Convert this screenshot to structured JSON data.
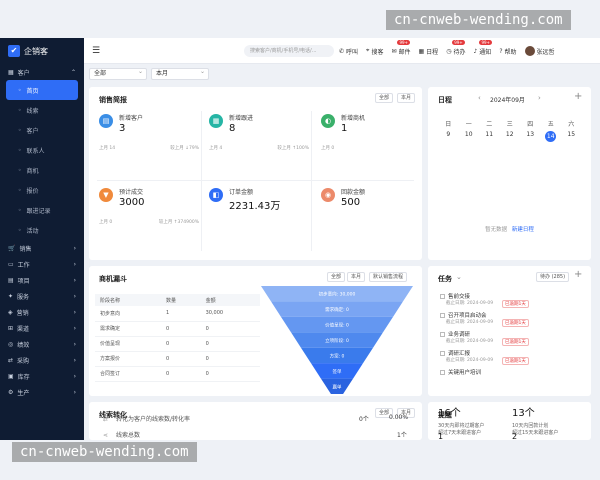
{
  "app": {
    "name": "企销客"
  },
  "watermark": {
    "top": "cn-cnweb-wending.com",
    "bottom": "cn-cnweb-wending.com"
  },
  "sidebar": {
    "groups": [
      {
        "label": "客户",
        "icon": "grid-icon",
        "expanded": true
      },
      {
        "label": "销售",
        "icon": "cart-icon"
      },
      {
        "label": "工作",
        "icon": "work-icon"
      },
      {
        "label": "项目",
        "icon": "project-icon"
      },
      {
        "label": "服务",
        "icon": "service-icon"
      },
      {
        "label": "营销",
        "icon": "marketing-icon"
      },
      {
        "label": "渠道",
        "icon": "channel-icon"
      },
      {
        "label": "绩效",
        "icon": "performance-icon"
      },
      {
        "label": "采购",
        "icon": "purchase-icon"
      },
      {
        "label": "库存",
        "icon": "inventory-icon"
      },
      {
        "label": "生产",
        "icon": "production-icon"
      }
    ],
    "sub_items": [
      {
        "label": "首页",
        "active": true
      },
      {
        "label": "线索"
      },
      {
        "label": "客户"
      },
      {
        "label": "联系人"
      },
      {
        "label": "商机"
      },
      {
        "label": "报价"
      },
      {
        "label": "跟进记录"
      },
      {
        "label": "活动"
      }
    ]
  },
  "topbar": {
    "search_placeholder": "搜索客户/商机/手机号/电话/...",
    "items": [
      {
        "label": "呼叫",
        "icon": "phone-icon"
      },
      {
        "label": "搜客",
        "icon": "location-icon"
      },
      {
        "label": "邮件",
        "icon": "mail-icon",
        "badge": "99+"
      },
      {
        "label": "日程",
        "icon": "calendar-icon"
      },
      {
        "label": "待办",
        "icon": "clock-icon",
        "badge": "99+"
      },
      {
        "label": "通知",
        "icon": "bell-icon",
        "badge": "99+"
      },
      {
        "label": "帮助",
        "icon": "help-icon"
      }
    ],
    "user": "张远哲"
  },
  "filters": {
    "scope": "全部",
    "period": "本月"
  },
  "sales_brief": {
    "title": "销售简报",
    "pills": [
      "全部",
      "本月"
    ],
    "kpis": [
      {
        "label": "新增客户",
        "value": "3",
        "prev": "上月 14",
        "cmp": "较上月 ↓79%",
        "color": "#3a8ee6",
        "icon": "customer-icon"
      },
      {
        "label": "新增跟进",
        "value": "8",
        "prev": "上月 4",
        "cmp": "较上月 ↑100%",
        "color": "#26b5a5",
        "icon": "followup-icon"
      },
      {
        "label": "新增商机",
        "value": "1",
        "prev": "上月 0",
        "cmp": "",
        "color": "#3ab06a",
        "icon": "opportunity-icon"
      },
      {
        "label": "预计成交",
        "value": "3000",
        "prev": "上月 0",
        "cmp": "较上月 ↑374900%",
        "color": "#f08a3c",
        "icon": "deal-icon"
      },
      {
        "label": "订单金额",
        "value": "2231.43万",
        "prev": "",
        "cmp": "",
        "color": "#2f6df6",
        "icon": "order-icon"
      },
      {
        "label": "回款金额",
        "value": "500",
        "prev": "",
        "cmp": "",
        "color": "#ec8a6a",
        "icon": "payment-icon"
      }
    ]
  },
  "calendar": {
    "title": "日程",
    "month": "2024年09月",
    "weekdays": [
      "日",
      "一",
      "二",
      "三",
      "四",
      "五",
      "六"
    ],
    "days": [
      "9",
      "10",
      "11",
      "12",
      "13",
      "14",
      "15"
    ],
    "today": "14",
    "empty": "暂无数据",
    "new_label": "新建日程"
  },
  "funnel": {
    "title": "商机漏斗",
    "pills": [
      "全部",
      "本月",
      "默认销售流程"
    ],
    "columns": [
      "阶段名称",
      "数量",
      "金额"
    ],
    "rows": [
      [
        "初步意向",
        "1",
        "30,000"
      ],
      [
        "需求确定",
        "0",
        "0"
      ],
      [
        "价值呈现",
        "0",
        "0"
      ],
      [
        "方案报价",
        "0",
        "0"
      ],
      [
        "合同签订",
        "0",
        "0"
      ]
    ],
    "chart_labels": [
      "初步意向: 30,000",
      "需求确定: 0",
      "价值呈现: 0",
      "立项阶段: 0",
      "方案: 0",
      "签单",
      "赢单"
    ]
  },
  "tasks": {
    "title": "任务",
    "pill": "待办 (285)",
    "items": [
      {
        "name": "售前交接",
        "date": "截止日期: 2024-09-09",
        "tag": "已逾期1天"
      },
      {
        "name": "召开项目启动会",
        "date": "截止日期: 2024-09-09",
        "tag": "已逾期1天"
      },
      {
        "name": "业务调研",
        "date": "截止日期: 2024-09-09",
        "tag": "已逾期1天"
      },
      {
        "name": "调研汇报",
        "date": "截止日期: 2024-09-09",
        "tag": "已逾期1天"
      },
      {
        "name": "关键用户培训",
        "date": "",
        "tag": ""
      }
    ]
  },
  "lead_conv": {
    "title": "线索转化",
    "pills": [
      "全部",
      "本月"
    ],
    "rows": [
      {
        "label": "线索总数",
        "value": "1个"
      },
      {
        "label": "转化为客户的线索数/转化率",
        "value": "0个",
        "rate": "0.00%"
      }
    ]
  },
  "reminders": {
    "title": "提醒",
    "items": [
      {
        "label": "超过7天未跟进客户",
        "value": "16个"
      },
      {
        "label": "超过15天未跟进客户",
        "value": "13个"
      },
      {
        "label": "30天内即将过期客户",
        "value": "1"
      },
      {
        "label": "10天内回款计划",
        "value": "2"
      }
    ]
  }
}
